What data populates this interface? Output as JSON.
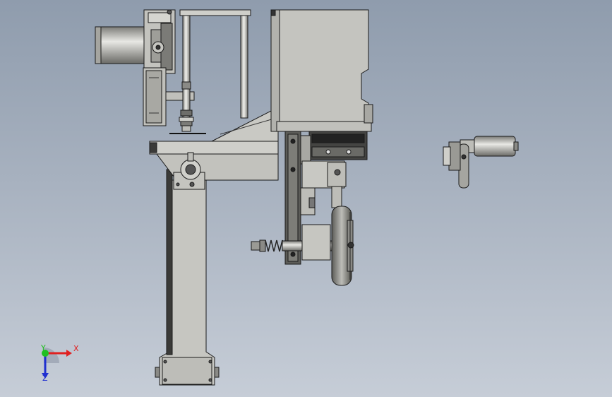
{
  "viewport": {
    "background_top": "#8f9cad",
    "background_bottom": "#c6cdd7"
  },
  "model": {
    "part_color": "#c8c8c4",
    "part_dark": "#6e6e6a",
    "edge_color": "#1a1a1a"
  },
  "triad": {
    "x_label": "X",
    "y_label": "Y",
    "z_label": "Z",
    "x_color": "#e02020",
    "y_color": "#20c020",
    "z_color": "#2030d0"
  }
}
